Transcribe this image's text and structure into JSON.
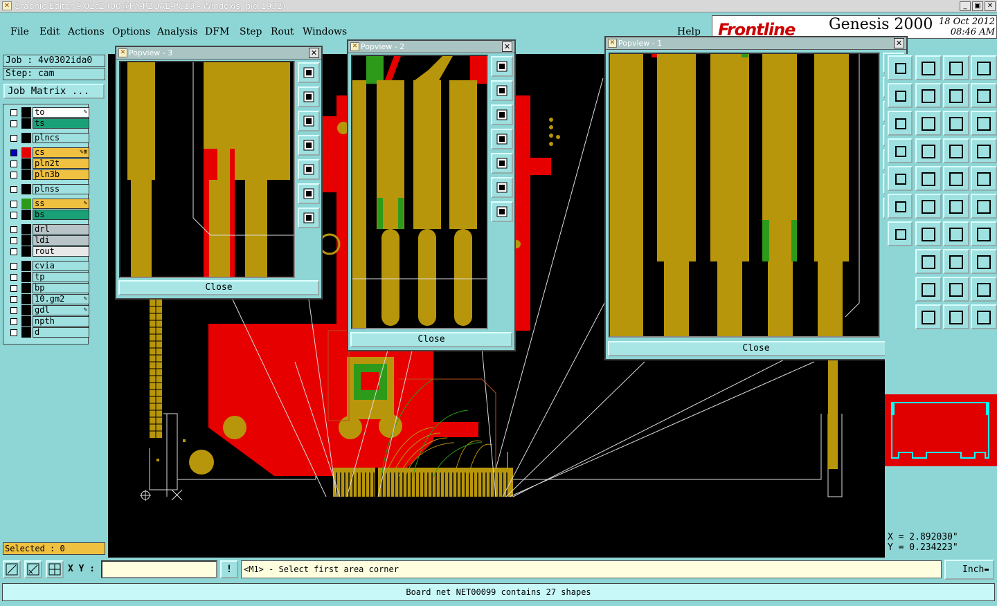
{
  "window": {
    "title": "Graphic Editor 9.02c2 (00@HY-P2QAE-PC13 - Windows, pid:1932)",
    "min": "_",
    "max": "▣",
    "close": "✕"
  },
  "menu": [
    "File",
    "Edit",
    "Actions",
    "Options",
    "Analysis",
    "DFM",
    "Step",
    "Rout",
    "Windows"
  ],
  "help": "Help",
  "brand": {
    "logo": "Frontline",
    "product": "Genesis 2000",
    "date": "18 Oct 2012",
    "time": "08:46 AM"
  },
  "job": {
    "job": "Job : 4v0302ida0",
    "step": "Step: cam",
    "matrix": "Job Matrix ..."
  },
  "layers": [
    {
      "name": "to",
      "color": "#ffffff",
      "mark": "✎"
    },
    {
      "name": "ts",
      "color": "#1aa077",
      "mark": ""
    },
    {
      "name": "plncs",
      "color": "#9fe0e0",
      "mark": ""
    },
    {
      "name": "cs",
      "color": "#f0c040",
      "mark": "✎⊞"
    },
    {
      "name": "pln2t",
      "color": "#f0c040",
      "mark": ""
    },
    {
      "name": "pln3b",
      "color": "#f0c040",
      "mark": ""
    },
    {
      "name": "plnss",
      "color": "#9fe0e0",
      "mark": ""
    },
    {
      "name": "ss",
      "color": "#f0c040",
      "mark": "✎"
    },
    {
      "name": "bs",
      "color": "#1aa077",
      "mark": ""
    },
    {
      "name": "drl",
      "color": "#b8c4c8",
      "mark": ""
    },
    {
      "name": "ldi",
      "color": "#b8c4c8",
      "mark": ""
    },
    {
      "name": "rout",
      "color": "#e8e8e8",
      "mark": ""
    },
    {
      "name": "cvia",
      "color": "#9fe0e0",
      "mark": ""
    },
    {
      "name": "tp",
      "color": "#9fe0e0",
      "mark": ""
    },
    {
      "name": "bp",
      "color": "#9fe0e0",
      "mark": ""
    },
    {
      "name": "10.gm2",
      "color": "#9fe0e0",
      "mark": "✎"
    },
    {
      "name": "gdl",
      "color": "#9fe0e0",
      "mark": "✎"
    },
    {
      "name": "npth",
      "color": "#9fe0e0",
      "mark": ""
    },
    {
      "name": "d",
      "color": "#9fe0e0",
      "mark": ""
    }
  ],
  "selected": "Selected : 0",
  "popups": {
    "p3": {
      "title": "Popview - 3",
      "close": "Close"
    },
    "p2": {
      "title": "Popview - 2",
      "close": "Close"
    },
    "p1": {
      "title": "Popview - 1",
      "close": "Close"
    },
    "x": "✕"
  },
  "coords": {
    "x": "X = 2.892030\"",
    "y": "Y = 0.234223\""
  },
  "bottom": {
    "xy_label": "X Y :",
    "excl": "!",
    "prompt": "<M1> - Select first area corner",
    "unit": "Inch",
    "status": "Board net NET00099 contains 27 shapes"
  },
  "colors": {
    "copper": "#b8960c",
    "plane": "#e60000",
    "mask": "#2e9a1a",
    "panel": "#8ed6d6"
  }
}
